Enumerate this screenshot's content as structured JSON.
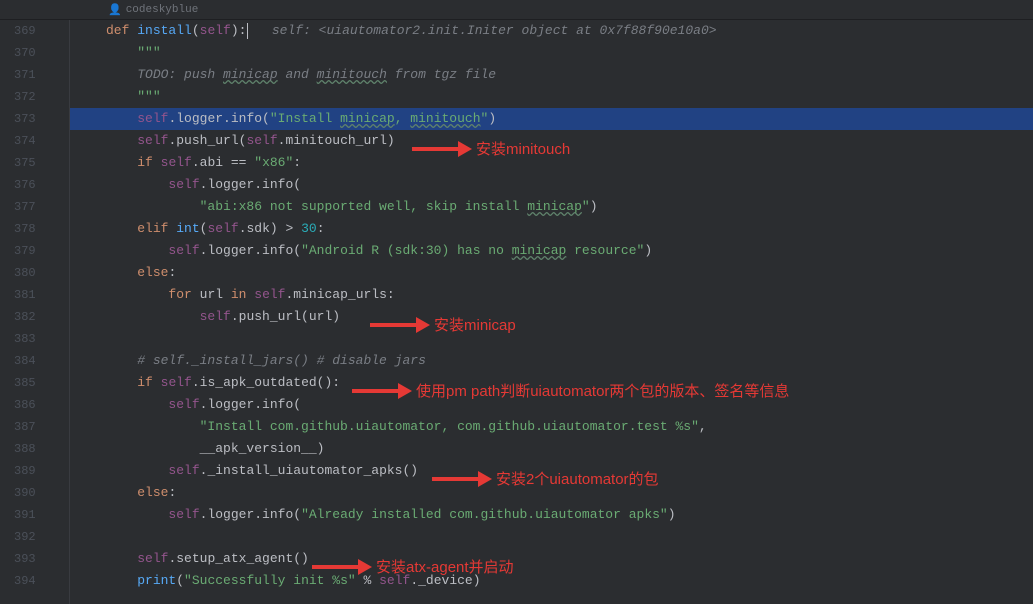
{
  "header": {
    "author": "codeskyblue"
  },
  "gutter": {
    "start": 369,
    "end": 394
  },
  "code": {
    "ln369": {
      "def": "def",
      "fn": "install",
      "self": "self",
      "hint": "self: <uiautomator2.init.Initer object at 0x7f88f90e10a0>"
    },
    "ln370": {
      "text": "\"\"\""
    },
    "ln371": {
      "todo": "TODO: push ",
      "w1": "minicap",
      "and": " and ",
      "w2": "minitouch",
      "from": " from tgz file"
    },
    "ln372": {
      "text": "\"\"\""
    },
    "ln373": {
      "self": "self",
      "logger": ".logger.info(",
      "str1": "\"Install ",
      "str2": "minicap",
      "str3": ", ",
      "str4": "minitouch",
      "str5": "\"",
      "close": ")"
    },
    "ln374": {
      "self": "self",
      "push": ".push_url(",
      "self2": "self",
      "mt": ".minitouch_url)"
    },
    "ln375": {
      "if": "if",
      "self": "self",
      "abi": ".abi == ",
      "str": "\"x86\"",
      "colon": ":"
    },
    "ln376": {
      "self": "self",
      "rest": ".logger.info("
    },
    "ln377": {
      "str1": "\"abi:x86 not supported well, skip install ",
      "w": "minicap",
      "str2": "\"",
      "close": ")"
    },
    "ln378": {
      "elif": "elif",
      "int": "int",
      "self": "self",
      "sdk": ".sdk) > ",
      "num": "30",
      "colon": ":"
    },
    "ln379": {
      "self": "self",
      "logger": ".logger.info(",
      "str1": "\"Android R (sdk:30) has no ",
      "w": "minicap",
      "str2": " resource\"",
      "close": ")"
    },
    "ln380": {
      "else": "else",
      "colon": ":"
    },
    "ln381": {
      "for": "for",
      "url": "url",
      "in": "in",
      "self": "self",
      "rest": ".minicap_urls:"
    },
    "ln382": {
      "self": "self",
      "rest": ".push_url(url)"
    },
    "ln384": {
      "comment": "# self._install_jars() # disable jars"
    },
    "ln385": {
      "if": "if",
      "self": "self",
      "rest": ".is_apk_outdated():"
    },
    "ln386": {
      "self": "self",
      "rest": ".logger.info("
    },
    "ln387": {
      "str": "\"Install com.github.uiautomator, com.github.uiautomator.test %s\"",
      "comma": ","
    },
    "ln388": {
      "text": "__apk_version__)"
    },
    "ln389": {
      "self": "self",
      "rest": "._install_uiautomator_apks()"
    },
    "ln390": {
      "else": "else",
      "colon": ":"
    },
    "ln391": {
      "self": "self",
      "logger": ".logger.info(",
      "str": "\"Already installed com.github.uiautomator apks\"",
      "close": ")"
    },
    "ln393": {
      "self": "self",
      "rest": ".setup_atx_agent()"
    },
    "ln394": {
      "print": "print",
      "open": "(",
      "str": "\"Successfully init %s\"",
      "pct": " % ",
      "self": "self",
      "rest": "._device)"
    }
  },
  "annotations": {
    "a1": "安装minitouch",
    "a2": "安装minicap",
    "a3": "使用pm path判断uiautomator两个包的版本、签名等信息",
    "a4": "安装2个uiautomator的包",
    "a5": "安装atx-agent并启动"
  }
}
